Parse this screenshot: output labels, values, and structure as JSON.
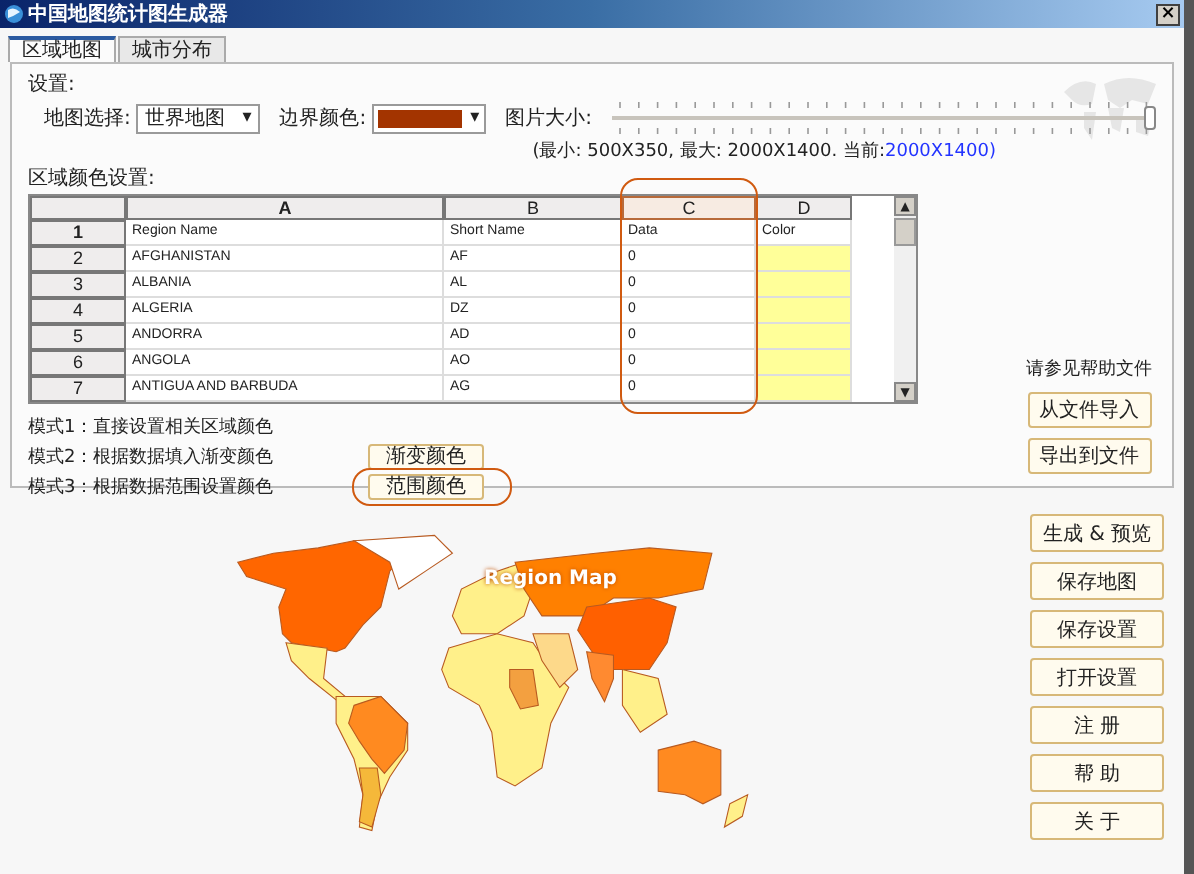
{
  "window": {
    "title": "中国地图统计图生成器",
    "close": "×"
  },
  "tabs": [
    {
      "label": "区域地图",
      "selected": true
    },
    {
      "label": "城市分布",
      "selected": false
    }
  ],
  "settings": {
    "label": "设置:",
    "map_select_label": "地图选择:",
    "map_select_value": "世界地图",
    "map_select_caret": "▾",
    "border_color_label": "边界颜色:",
    "border_color": {
      "color": "#a33400",
      "caret": "▾"
    },
    "image_size_label": "图片大小:",
    "image_size_slider": {
      "level": 1.0
    },
    "size_info": "(最小: 500X350, 最大: 2000X1400. 当前:",
    "size_current": "2000X1400)"
  },
  "region_color_label": "区域颜色设置:",
  "scrollbar": {
    "up": "▲",
    "down": "▼"
  },
  "table": {
    "columns": [
      {
        "label": "A",
        "bold": true,
        "highlighted": false
      },
      {
        "label": "B",
        "bold": false,
        "highlighted": false
      },
      {
        "label": "C",
        "bold": false,
        "highlighted": true
      },
      {
        "label": "D",
        "bold": false,
        "highlighted": false
      }
    ],
    "rows": [
      {
        "num": "1",
        "cells": [
          "Region Name",
          "Short Name",
          "Data",
          "Color"
        ],
        "color": "#ffffff"
      },
      {
        "num": "2",
        "cells": [
          "AFGHANISTAN",
          "AF",
          "0",
          ""
        ],
        "color": "#ffff99"
      },
      {
        "num": "3",
        "cells": [
          "ALBANIA",
          "AL",
          "0",
          ""
        ],
        "color": "#ffff99"
      },
      {
        "num": "4",
        "cells": [
          "ALGERIA",
          "DZ",
          "0",
          ""
        ],
        "color": "#ffff99"
      },
      {
        "num": "5",
        "cells": [
          "ANDORRA",
          "AD",
          "0",
          ""
        ],
        "color": "#ffff99"
      },
      {
        "num": "6",
        "cells": [
          "ANGOLA",
          "AO",
          "0",
          ""
        ],
        "color": "#ffff99"
      },
      {
        "num": "7",
        "cells": [
          "ANTIGUA AND BARBUDA",
          "AG",
          "0",
          ""
        ],
        "color": "#ffff99"
      }
    ]
  },
  "modes": [
    {
      "text": "模式1：直接设置相关区域颜色"
    },
    {
      "text": "模式2：根据数据填入渐变颜色",
      "button": "渐变颜色",
      "highlighted": false
    },
    {
      "text": "模式3：根据数据范围设置颜色",
      "button": "范围颜色",
      "highlighted": true
    }
  ],
  "help_text": "请参见帮助文件",
  "file_buttons": [
    "从文件导入",
    "导出到文件"
  ],
  "map_title": "Region Map",
  "side_buttons": [
    "生成 & 预览",
    "保存地图",
    "保存设置",
    "打开设置",
    "注  册",
    "帮  助",
    "关  于"
  ]
}
